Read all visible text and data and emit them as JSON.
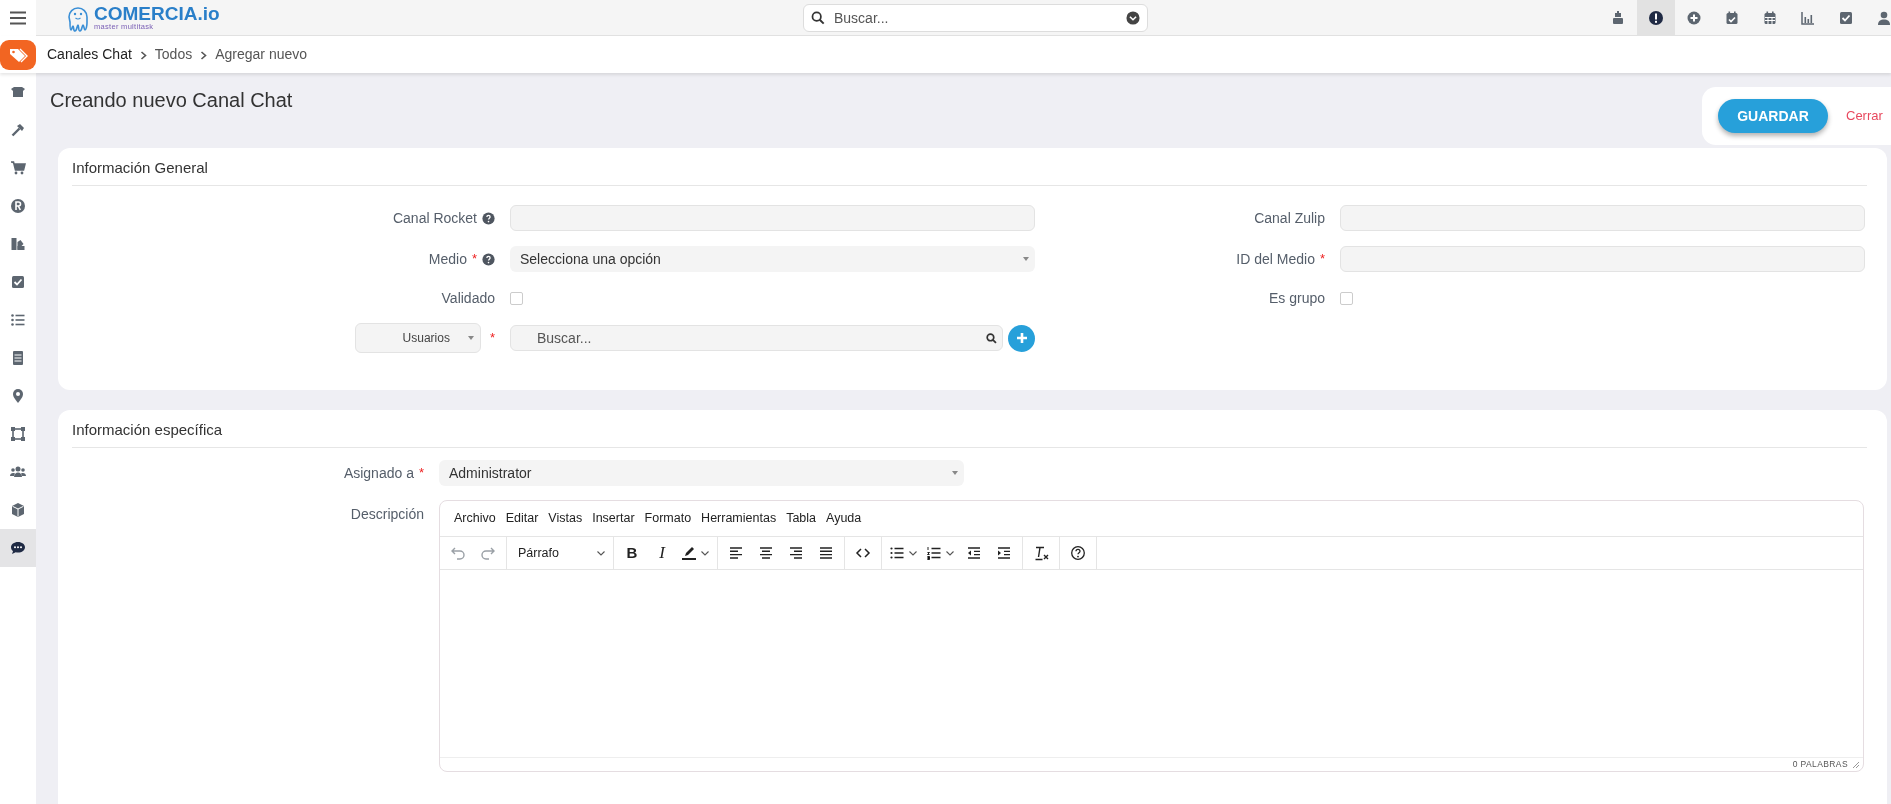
{
  "logo": {
    "name": "COMERCIA.io",
    "tagline": "master multitask"
  },
  "search": {
    "placeholder": "Buscar..."
  },
  "toolbar_icons": [
    {
      "kind": "register",
      "selected": false
    },
    {
      "kind": "alert",
      "selected": true
    },
    {
      "kind": "plus",
      "selected": false
    },
    {
      "kind": "calendar-check",
      "selected": false
    },
    {
      "kind": "calendar",
      "selected": false
    },
    {
      "kind": "chart",
      "selected": false
    },
    {
      "kind": "check",
      "selected": false
    },
    {
      "kind": "user",
      "selected": false
    }
  ],
  "breadcrumb": [
    "Canales Chat",
    "Todos",
    "Agregar nuevo"
  ],
  "sidebar": {
    "items": [
      {
        "kind": "box",
        "selected": false
      },
      {
        "kind": "hammer",
        "selected": false
      },
      {
        "kind": "cart",
        "selected": false
      },
      {
        "kind": "registered",
        "selected": false
      },
      {
        "kind": "swatch",
        "selected": false
      },
      {
        "kind": "check",
        "selected": false
      },
      {
        "kind": "list",
        "selected": false
      },
      {
        "kind": "cabinet",
        "selected": false
      },
      {
        "kind": "pin",
        "selected": false
      },
      {
        "kind": "nodes",
        "selected": false
      },
      {
        "kind": "users",
        "selected": false
      },
      {
        "kind": "cube",
        "selected": false
      },
      {
        "kind": "chat",
        "selected": true
      }
    ]
  },
  "page_title": "Creando nuevo Canal Chat",
  "actions": {
    "save": "GUARDAR",
    "close": "Cerrar"
  },
  "general": {
    "title": "Información General",
    "columns": [
      [
        {
          "kind": "text",
          "label": "Canal Rocket",
          "help": true
        },
        {
          "kind": "select",
          "label": "Medio",
          "marker": "*",
          "help": true,
          "value": "Selecciona una opción"
        },
        {
          "kind": "checkbox",
          "label": "Validado",
          "checked": false
        },
        {
          "kind": "lookup",
          "selector": "Usuarios",
          "marker": "*",
          "placeholder": "Buscar..."
        }
      ],
      [
        {
          "kind": "text",
          "label": "Canal Zulip",
          "help": false
        },
        {
          "kind": "text",
          "label": "ID del Medio",
          "marker": "*",
          "help": false
        },
        {
          "kind": "checkbox",
          "label": "Es grupo",
          "checked": false
        }
      ]
    ]
  },
  "specific": {
    "title": "Información específica",
    "fields": [
      {
        "kind": "select",
        "label": "Asignado a",
        "marker": "*",
        "help": false,
        "value": "Administrator"
      },
      {
        "kind": "editor",
        "label": "Descripción",
        "help": false,
        "menu": [
          "Archivo",
          "Editar",
          "Vistas",
          "Insertar",
          "Formato",
          "Herramientas",
          "Tabla",
          "Ayuda"
        ],
        "tools": [
          [
            {
              "kind": "undo",
              "disabled": true
            },
            {
              "kind": "redo",
              "disabled": true
            }
          ],
          [
            {
              "kind": "blocks",
              "label": "Párrafo",
              "disabled": false
            }
          ],
          [
            {
              "kind": "bold",
              "label": "B",
              "disabled": false
            },
            {
              "kind": "italic",
              "label": "I",
              "disabled": false
            },
            {
              "kind": "highlight",
              "disabled": false
            }
          ],
          [
            {
              "kind": "align-left",
              "disabled": false
            },
            {
              "kind": "align-center",
              "disabled": false
            },
            {
              "kind": "align-right",
              "disabled": false
            },
            {
              "kind": "justify",
              "disabled": false
            }
          ],
          [
            {
              "kind": "code",
              "disabled": false
            }
          ],
          [
            {
              "kind": "bullets",
              "disabled": false
            },
            {
              "kind": "numbers",
              "disabled": false
            },
            {
              "kind": "outdent",
              "disabled": false
            },
            {
              "kind": "indent",
              "disabled": false
            }
          ],
          [
            {
              "kind": "clear",
              "disabled": false
            }
          ],
          [
            {
              "kind": "help",
              "disabled": false
            }
          ]
        ],
        "word_count": "0 PALABRAS"
      }
    ]
  }
}
